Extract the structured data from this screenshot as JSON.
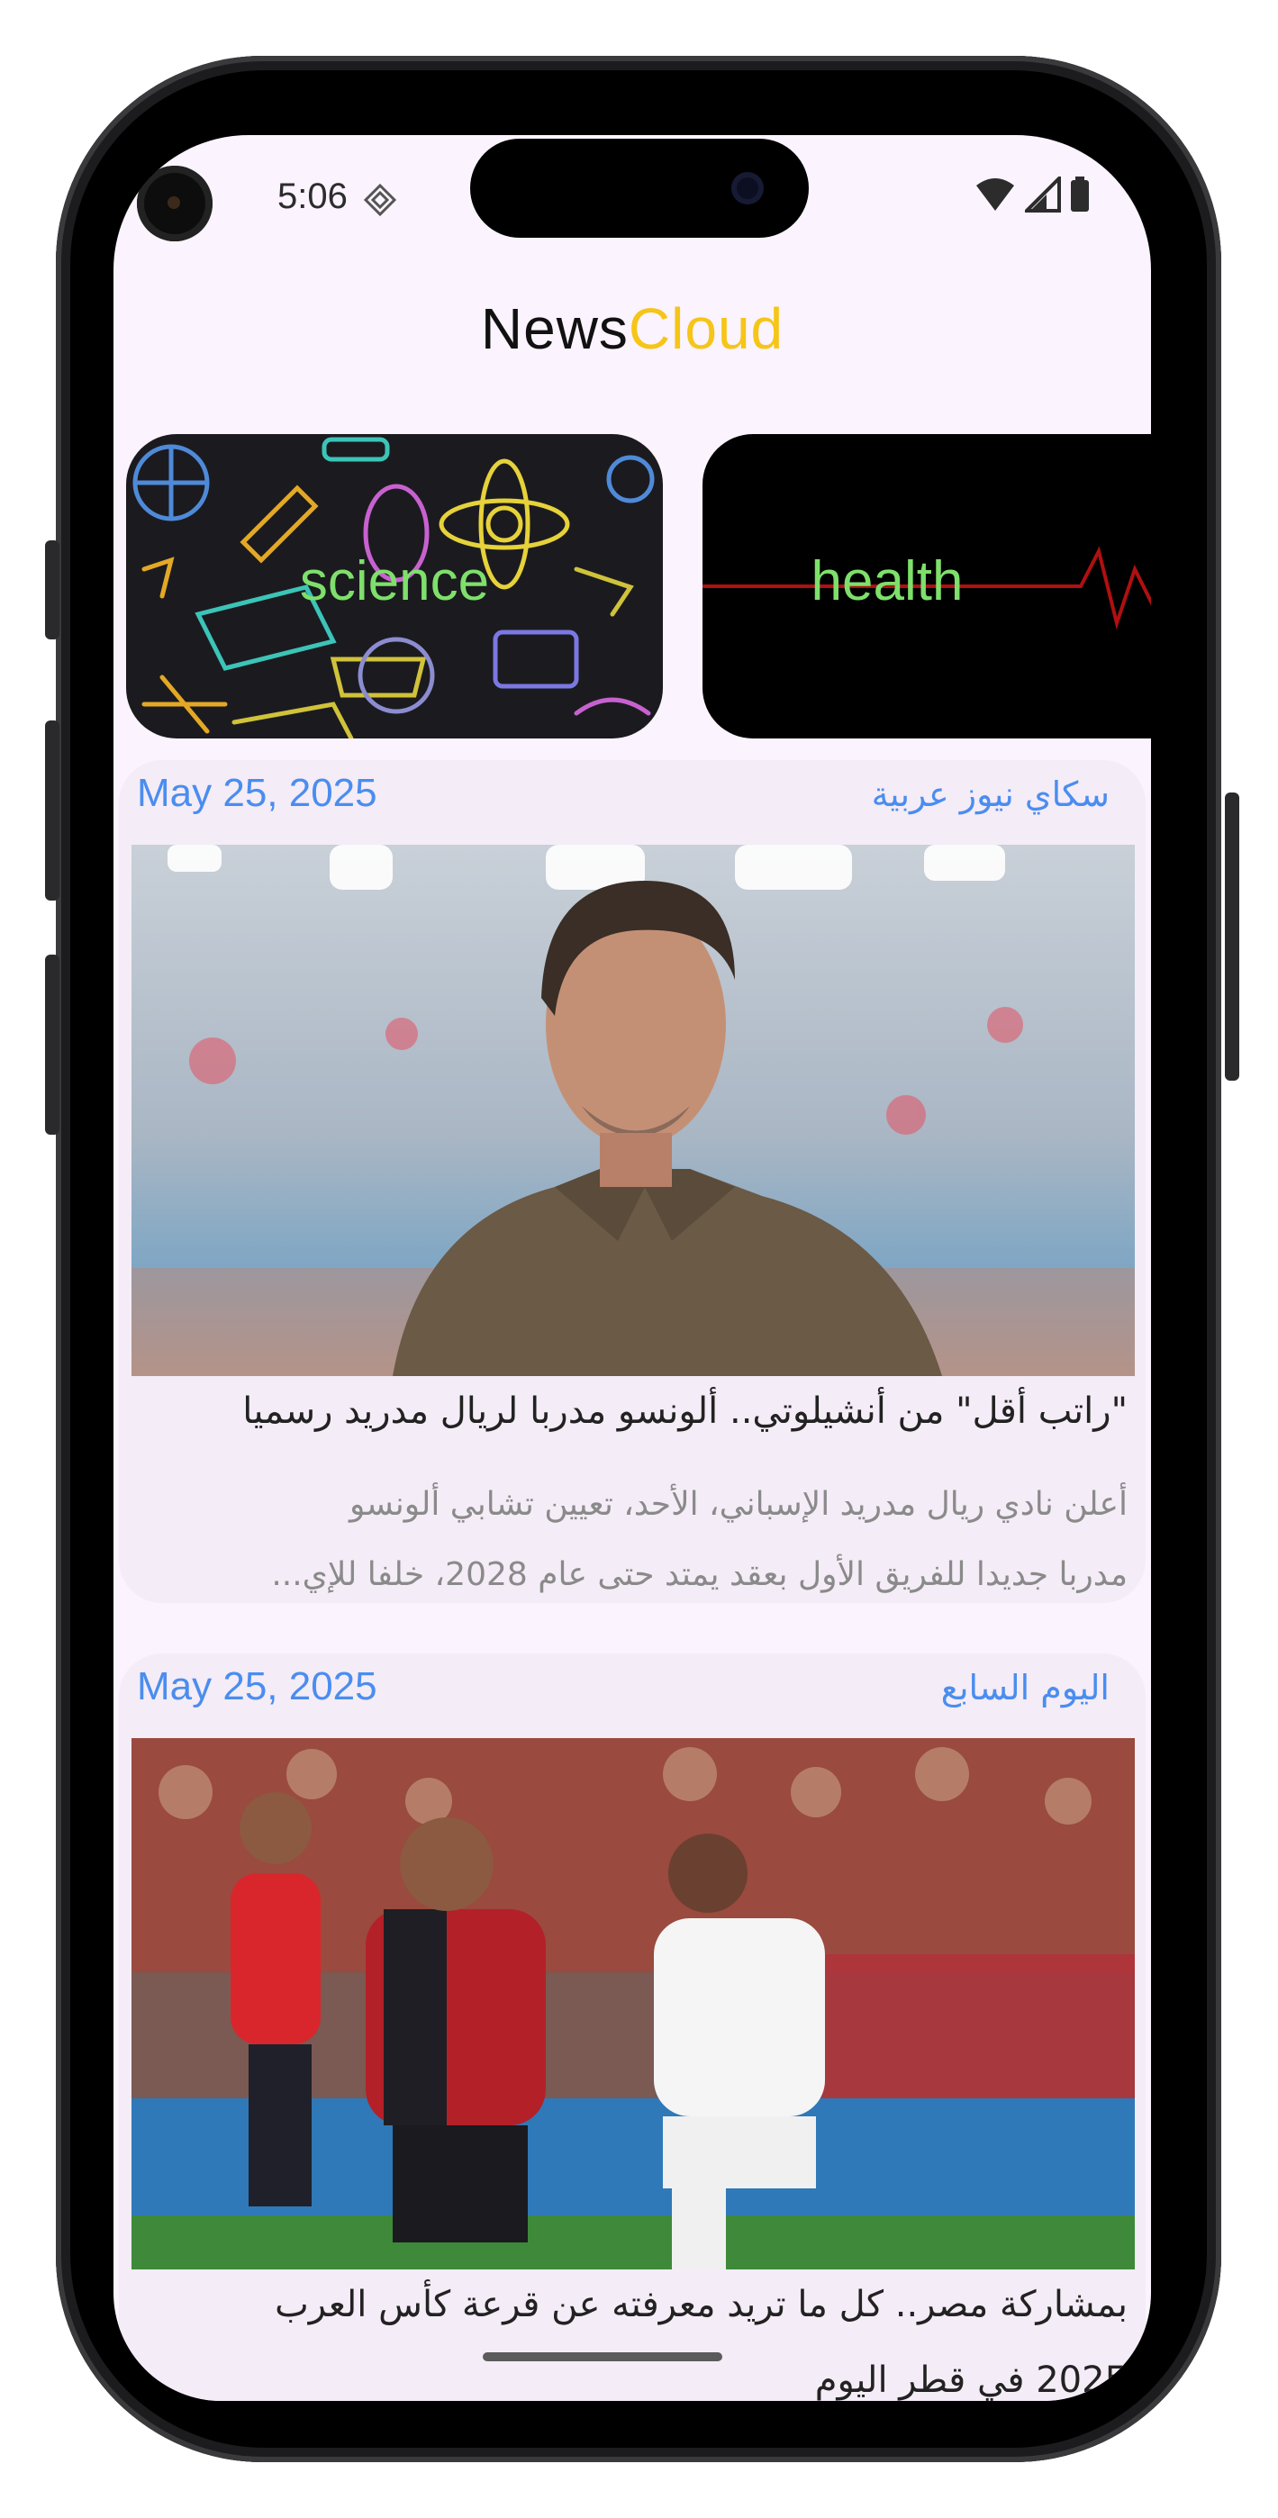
{
  "status_bar": {
    "time": "5:06"
  },
  "app": {
    "title_part1": "News",
    "title_part2": "Cloud"
  },
  "categories": [
    {
      "label": "science"
    },
    {
      "label": "health"
    }
  ],
  "articles": [
    {
      "date": "May 25, 2025",
      "source": "سكاي نيوز عربية",
      "title": "\"راتب أقل\" من أنشيلوتي.. ألونسو مدربا لريال مدريد رسميا",
      "description_lines": [
        "أعلن نادي ريال مدريد الإسباني، الأحد، تعيين تشابي ألونسو",
        "مدربا جديدا للفريق الأول بعقد يمتد حتى عام 2028، خلفا للإي..."
      ]
    },
    {
      "date": "May 25, 2025",
      "source": "اليوم السابع",
      "title": "بمشاركة مصر.. كل ما تريد معرفته عن قرعة كأس العرب",
      "description_lines": [
        "2025 في قطر اليوم"
      ]
    }
  ],
  "colors": {
    "accent": "#f5c518",
    "link_blue": "#4a8df0",
    "category_text": "#7ee06b",
    "screen_bg": "#fbf3fd",
    "card_bg": "#f4ecf6"
  },
  "icons": [
    "gesture-diamond-icon",
    "wifi-icon",
    "signal-icon",
    "battery-icon"
  ]
}
